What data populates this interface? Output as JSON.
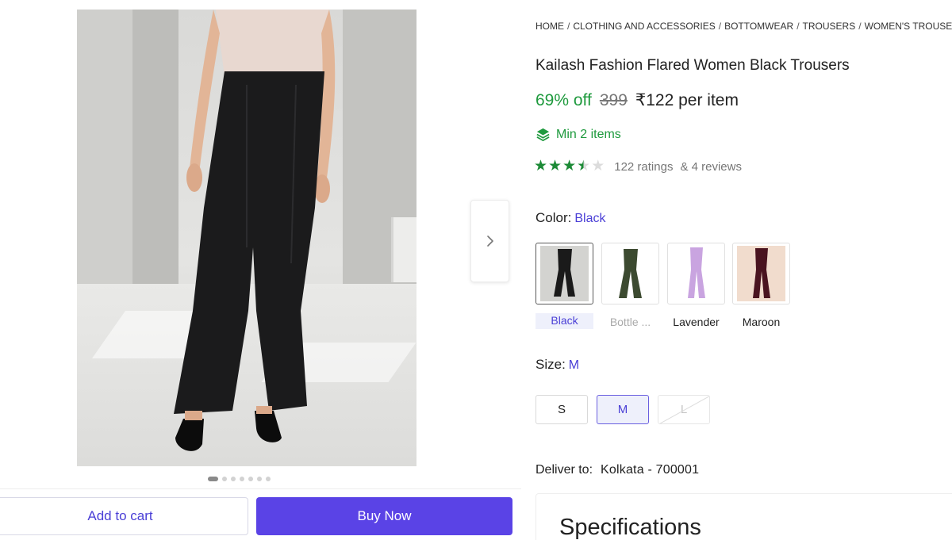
{
  "breadcrumb": [
    "HOME",
    "CLOTHING AND ACCESSORIES",
    "BOTTOMWEAR",
    "TROUSERS",
    "WOMEN'S TROUSERS"
  ],
  "product": {
    "title": "Kailash Fashion Flared Women Black Trousers",
    "discount": "69% off",
    "mrp": "399",
    "price": "₹122 per item",
    "min_items": "Min 2 items",
    "rating_value": 3.5,
    "ratings_count": "122 ratings",
    "reviews_count": "& 4 reviews"
  },
  "color": {
    "label": "Color:",
    "selected": "Black",
    "options": [
      {
        "label": "Black",
        "swatch": "#1a1a1a"
      },
      {
        "label": "Bottle ...",
        "swatch": "#3c4a30"
      },
      {
        "label": "Lavender",
        "swatch": "#c9a4e0"
      },
      {
        "label": "Maroon",
        "swatch": "#4a1420"
      }
    ]
  },
  "size": {
    "label": "Size:",
    "selected": "M",
    "options": [
      {
        "label": "S",
        "state": "available"
      },
      {
        "label": "M",
        "state": "selected"
      },
      {
        "label": "L",
        "state": "unavailable"
      }
    ]
  },
  "delivery": {
    "label": "Deliver to:",
    "location": "Kolkata - 700001"
  },
  "specifications": {
    "title": "Specifications"
  },
  "gallery": {
    "total_images": 7,
    "active_index": 0,
    "next_icon": "chevron-right-icon"
  },
  "actions": {
    "add_to_cart": "Add to cart",
    "buy_now": "Buy Now"
  },
  "colors": {
    "accent": "#5a43e6",
    "success": "#1f9a3e"
  }
}
